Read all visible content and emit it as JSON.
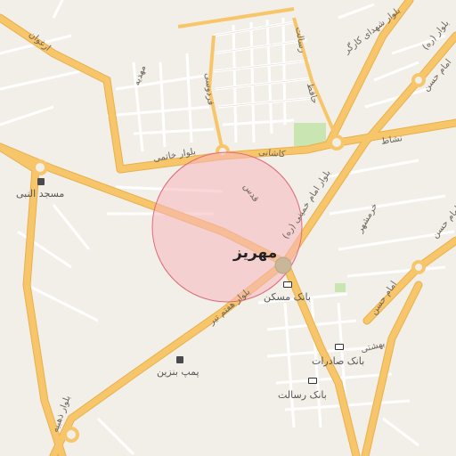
{
  "map": {
    "city_name": "مهریز",
    "colors": {
      "background": "#f2efe9",
      "major_road": "#f7c66a",
      "major_road_casing": "#e8b04c",
      "minor_road": "#ffffff",
      "minor_road_casing": "#d9d3c8",
      "park": "#c9e6b2",
      "highlight_circle_fill": "#f8b6bd",
      "highlight_circle_stroke": "#e06a78"
    },
    "road_labels": {
      "arghavan": "ارغوان",
      "mahdieh": "مهدیه",
      "khatami": "بلوار خاتمی",
      "ferdowsi": "فردوسی",
      "resalat": "رسالت",
      "hafez": "حافظ",
      "kashani": "کاشانی",
      "shohada": "بلوار شهدای کارگر",
      "imam_hasan_top": "امام حسن",
      "neshat": "نشاط",
      "bolvar_top_right": "بلوار (ره)",
      "imam_khomeini": "بلوار امام خمینی (ره)",
      "qods": "قدس",
      "khorramshahr": "خرمشهر",
      "imam_hasan_right": "امام حسن",
      "imam_hasan_mid": "امام حسن",
      "haftom_tir": "بلوار هفتم تیر",
      "zahabieh": "بلوار ذهبیه",
      "bahonar": "بهشتی"
    },
    "pois": [
      {
        "id": "masjed",
        "icon": "mosque-icon",
        "label": "مسجد النبی"
      },
      {
        "id": "bank_maskan",
        "icon": "bank-icon",
        "label": "بانک مسکن"
      },
      {
        "id": "bank_saderat",
        "icon": "bank-icon",
        "label": "بانک صادرات"
      },
      {
        "id": "bank_resalat",
        "icon": "bank-icon",
        "label": "بانک رسالت"
      },
      {
        "id": "pump",
        "icon": "fuel-pump-icon",
        "label": "پمپ بنزین"
      }
    ]
  }
}
